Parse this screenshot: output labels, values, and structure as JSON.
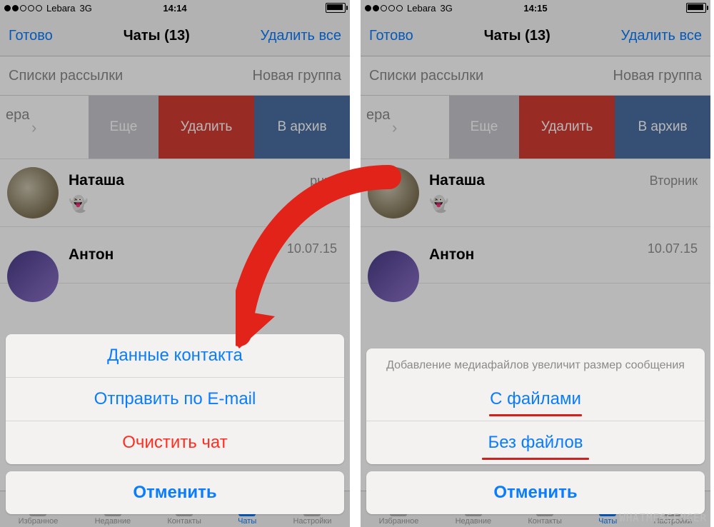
{
  "left": {
    "status": {
      "carrier": "Lebara",
      "network": "3G",
      "time": "14:14"
    },
    "nav": {
      "done": "Готово",
      "title": "Чаты (13)",
      "delete_all": "Удалить все"
    },
    "subbar": {
      "broadcast": "Списки рассылки",
      "new_group": "Новая группа"
    },
    "swipe": {
      "prefix": "ера",
      "more": "Еще",
      "delete": "Удалить",
      "archive": "В архив"
    },
    "chats": [
      {
        "name": "Наташа",
        "meta": "рник",
        "ghost": "👻"
      },
      {
        "name": "Антон",
        "meta": "10.07.15"
      }
    ],
    "sheet": {
      "contact": "Данные контакта",
      "email": "Отправить по E-mail",
      "clear": "Очистить чат",
      "cancel": "Отменить"
    },
    "tabs": [
      "Избранное",
      "Недавние",
      "Контакты",
      "Чаты",
      "Настройки"
    ]
  },
  "right": {
    "status": {
      "carrier": "Lebara",
      "network": "3G",
      "time": "14:15"
    },
    "nav": {
      "done": "Готово",
      "title": "Чаты (13)",
      "delete_all": "Удалить все"
    },
    "subbar": {
      "broadcast": "Списки рассылки",
      "new_group": "Новая группа"
    },
    "swipe": {
      "prefix": "ера",
      "more": "Еще",
      "delete": "Удалить",
      "archive": "В архив"
    },
    "chats": [
      {
        "name": "Наташа",
        "meta": "Вторник",
        "ghost": "👻"
      },
      {
        "name": "Антон",
        "meta": "10.07.15"
      }
    ],
    "sheet": {
      "message": "Добавление медиафайлов увеличит размер сообщения",
      "with_files": "С файлами",
      "without_files": "Без файлов",
      "cancel": "Отменить"
    },
    "tabs": [
      "Избранное",
      "Недавние",
      "Контакты",
      "Чаты",
      "Настройки"
    ]
  },
  "watermark": "WHATMESSENGER"
}
